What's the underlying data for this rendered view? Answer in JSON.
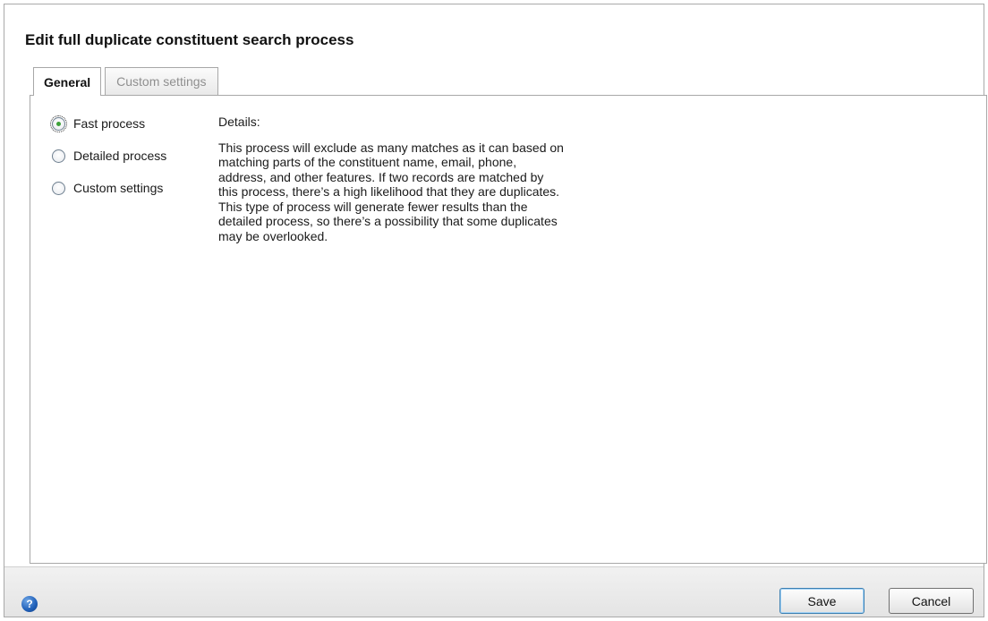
{
  "dialog": {
    "title": "Edit full duplicate constituent search process"
  },
  "tabs": [
    {
      "label": "General",
      "active": true
    },
    {
      "label": "Custom settings",
      "active": false
    }
  ],
  "options": [
    {
      "label": "Fast process",
      "selected": true
    },
    {
      "label": "Detailed process",
      "selected": false
    },
    {
      "label": "Custom settings",
      "selected": false
    }
  ],
  "details": {
    "label": "Details:",
    "text": "This process will exclude as many matches as it can based on\nmatching parts of the constituent name, email, phone,\naddress, and other features.  If two records are matched by\nthis process, there’s a high likelihood that they are duplicates.\nThis type of process will generate fewer results than the\ndetailed process, so there’s a possibility that some duplicates\nmay be overlooked."
  },
  "footer": {
    "help_icon": "?",
    "save_label": "Save",
    "cancel_label": "Cancel"
  },
  "colors": {
    "radio_selected": "#3ea13a",
    "help_icon": "#1f5fb8"
  }
}
